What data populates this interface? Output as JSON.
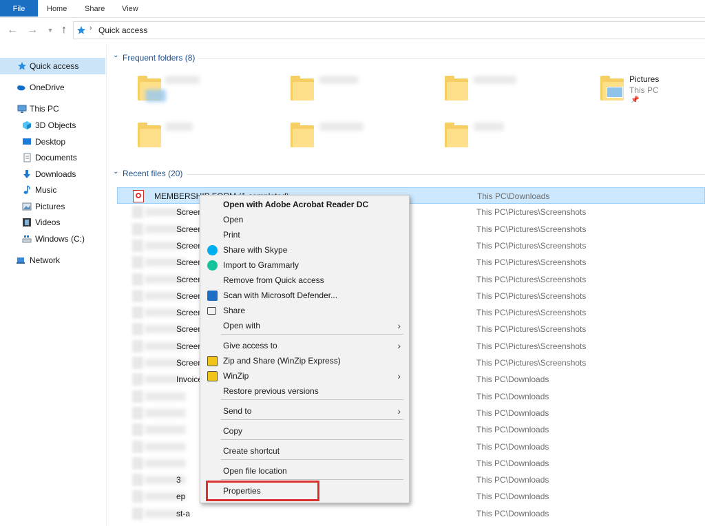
{
  "ribbon": {
    "tabs": [
      "File",
      "Home",
      "Share",
      "View"
    ]
  },
  "address": {
    "crumb": "Quick access"
  },
  "sidebar": {
    "items": [
      {
        "label": "Quick access",
        "icon": "star-icon"
      },
      {
        "label": "OneDrive",
        "icon": "cloud-icon"
      },
      {
        "label": "This PC",
        "icon": "computer-icon"
      },
      {
        "label": "3D Objects",
        "icon": "cube-icon"
      },
      {
        "label": "Desktop",
        "icon": "desktop-icon"
      },
      {
        "label": "Documents",
        "icon": "documents-icon"
      },
      {
        "label": "Downloads",
        "icon": "download-icon"
      },
      {
        "label": "Music",
        "icon": "music-note-icon"
      },
      {
        "label": "Pictures",
        "icon": "pictures-icon"
      },
      {
        "label": "Videos",
        "icon": "film-icon"
      },
      {
        "label": "Windows (C:)",
        "icon": "drive-icon"
      },
      {
        "label": "Network",
        "icon": "network-icon"
      }
    ]
  },
  "frequent": {
    "header": "Frequent folders (8)",
    "pictures": {
      "name": "Pictures",
      "sub": "This PC"
    }
  },
  "recent": {
    "header": "Recent files (20)",
    "rows": [
      {
        "name": "MEMBERSHIP FORM (1 completed)",
        "location": "This PC\\Downloads"
      },
      {
        "name": "Screenshot (5",
        "location": "This PC\\Pictures\\Screenshots"
      },
      {
        "name": "Screenshot (5",
        "location": "This PC\\Pictures\\Screenshots"
      },
      {
        "name": "Screenshot (5",
        "location": "This PC\\Pictures\\Screenshots"
      },
      {
        "name": "Screenshot (5",
        "location": "This PC\\Pictures\\Screenshots"
      },
      {
        "name": "Screenshot (5",
        "location": "This PC\\Pictures\\Screenshots"
      },
      {
        "name": "Screenshot (4",
        "location": "This PC\\Pictures\\Screenshots"
      },
      {
        "name": "Screenshot (4",
        "location": "This PC\\Pictures\\Screenshots"
      },
      {
        "name": "Screenshot (4",
        "location": "This PC\\Pictures\\Screenshots"
      },
      {
        "name": "Screenshot (4",
        "location": "This PC\\Pictures\\Screenshots"
      },
      {
        "name": "Screenshot (4",
        "location": "This PC\\Pictures\\Screenshots"
      },
      {
        "name": "Invoice_Zoolo",
        "location": "This PC\\Downloads"
      },
      {
        "name": "",
        "location": "This PC\\Downloads"
      },
      {
        "name": "",
        "location": "This PC\\Downloads"
      },
      {
        "name": "",
        "location": "This PC\\Downloads"
      },
      {
        "name": "",
        "location": "This PC\\Downloads"
      },
      {
        "name": "",
        "location": "This PC\\Downloads"
      },
      {
        "name": "3",
        "location": "This PC\\Downloads"
      },
      {
        "name": "ep",
        "location": "This PC\\Downloads"
      },
      {
        "name": "st-a",
        "location": "This PC\\Downloads"
      }
    ]
  },
  "context_menu": {
    "items": [
      {
        "label": "Open with Adobe Acrobat Reader DC",
        "bold": true,
        "icon": ""
      },
      {
        "label": "Open",
        "icon": ""
      },
      {
        "label": "Print",
        "icon": ""
      },
      {
        "label": "Share with Skype",
        "icon": "skype-icon"
      },
      {
        "label": "Import to Grammarly",
        "icon": "grammarly-icon"
      },
      {
        "label": "Remove from Quick access",
        "icon": ""
      },
      {
        "label": "Scan with Microsoft Defender...",
        "icon": "defender-shield-icon"
      },
      {
        "label": "Share",
        "icon": "share-icon"
      },
      {
        "label": "Open with",
        "icon": "",
        "submenu": true
      },
      {
        "label": "Give access to",
        "icon": "",
        "submenu": true
      },
      {
        "label": "Zip and Share (WinZip Express)",
        "icon": "winzip-icon"
      },
      {
        "label": "WinZip",
        "icon": "winzip-icon",
        "submenu": true
      },
      {
        "label": "Restore previous versions",
        "icon": ""
      },
      {
        "label": "Send to",
        "icon": "",
        "submenu": true
      },
      {
        "label": "Copy",
        "icon": ""
      },
      {
        "label": "Create shortcut",
        "icon": ""
      },
      {
        "label": "Open file location",
        "icon": ""
      },
      {
        "label": "Properties",
        "icon": ""
      }
    ],
    "highlighted": "Properties"
  },
  "colors": {
    "accent": "#1a6fc4",
    "selection": "#cce8ff",
    "highlight_box": "#d9302c"
  }
}
